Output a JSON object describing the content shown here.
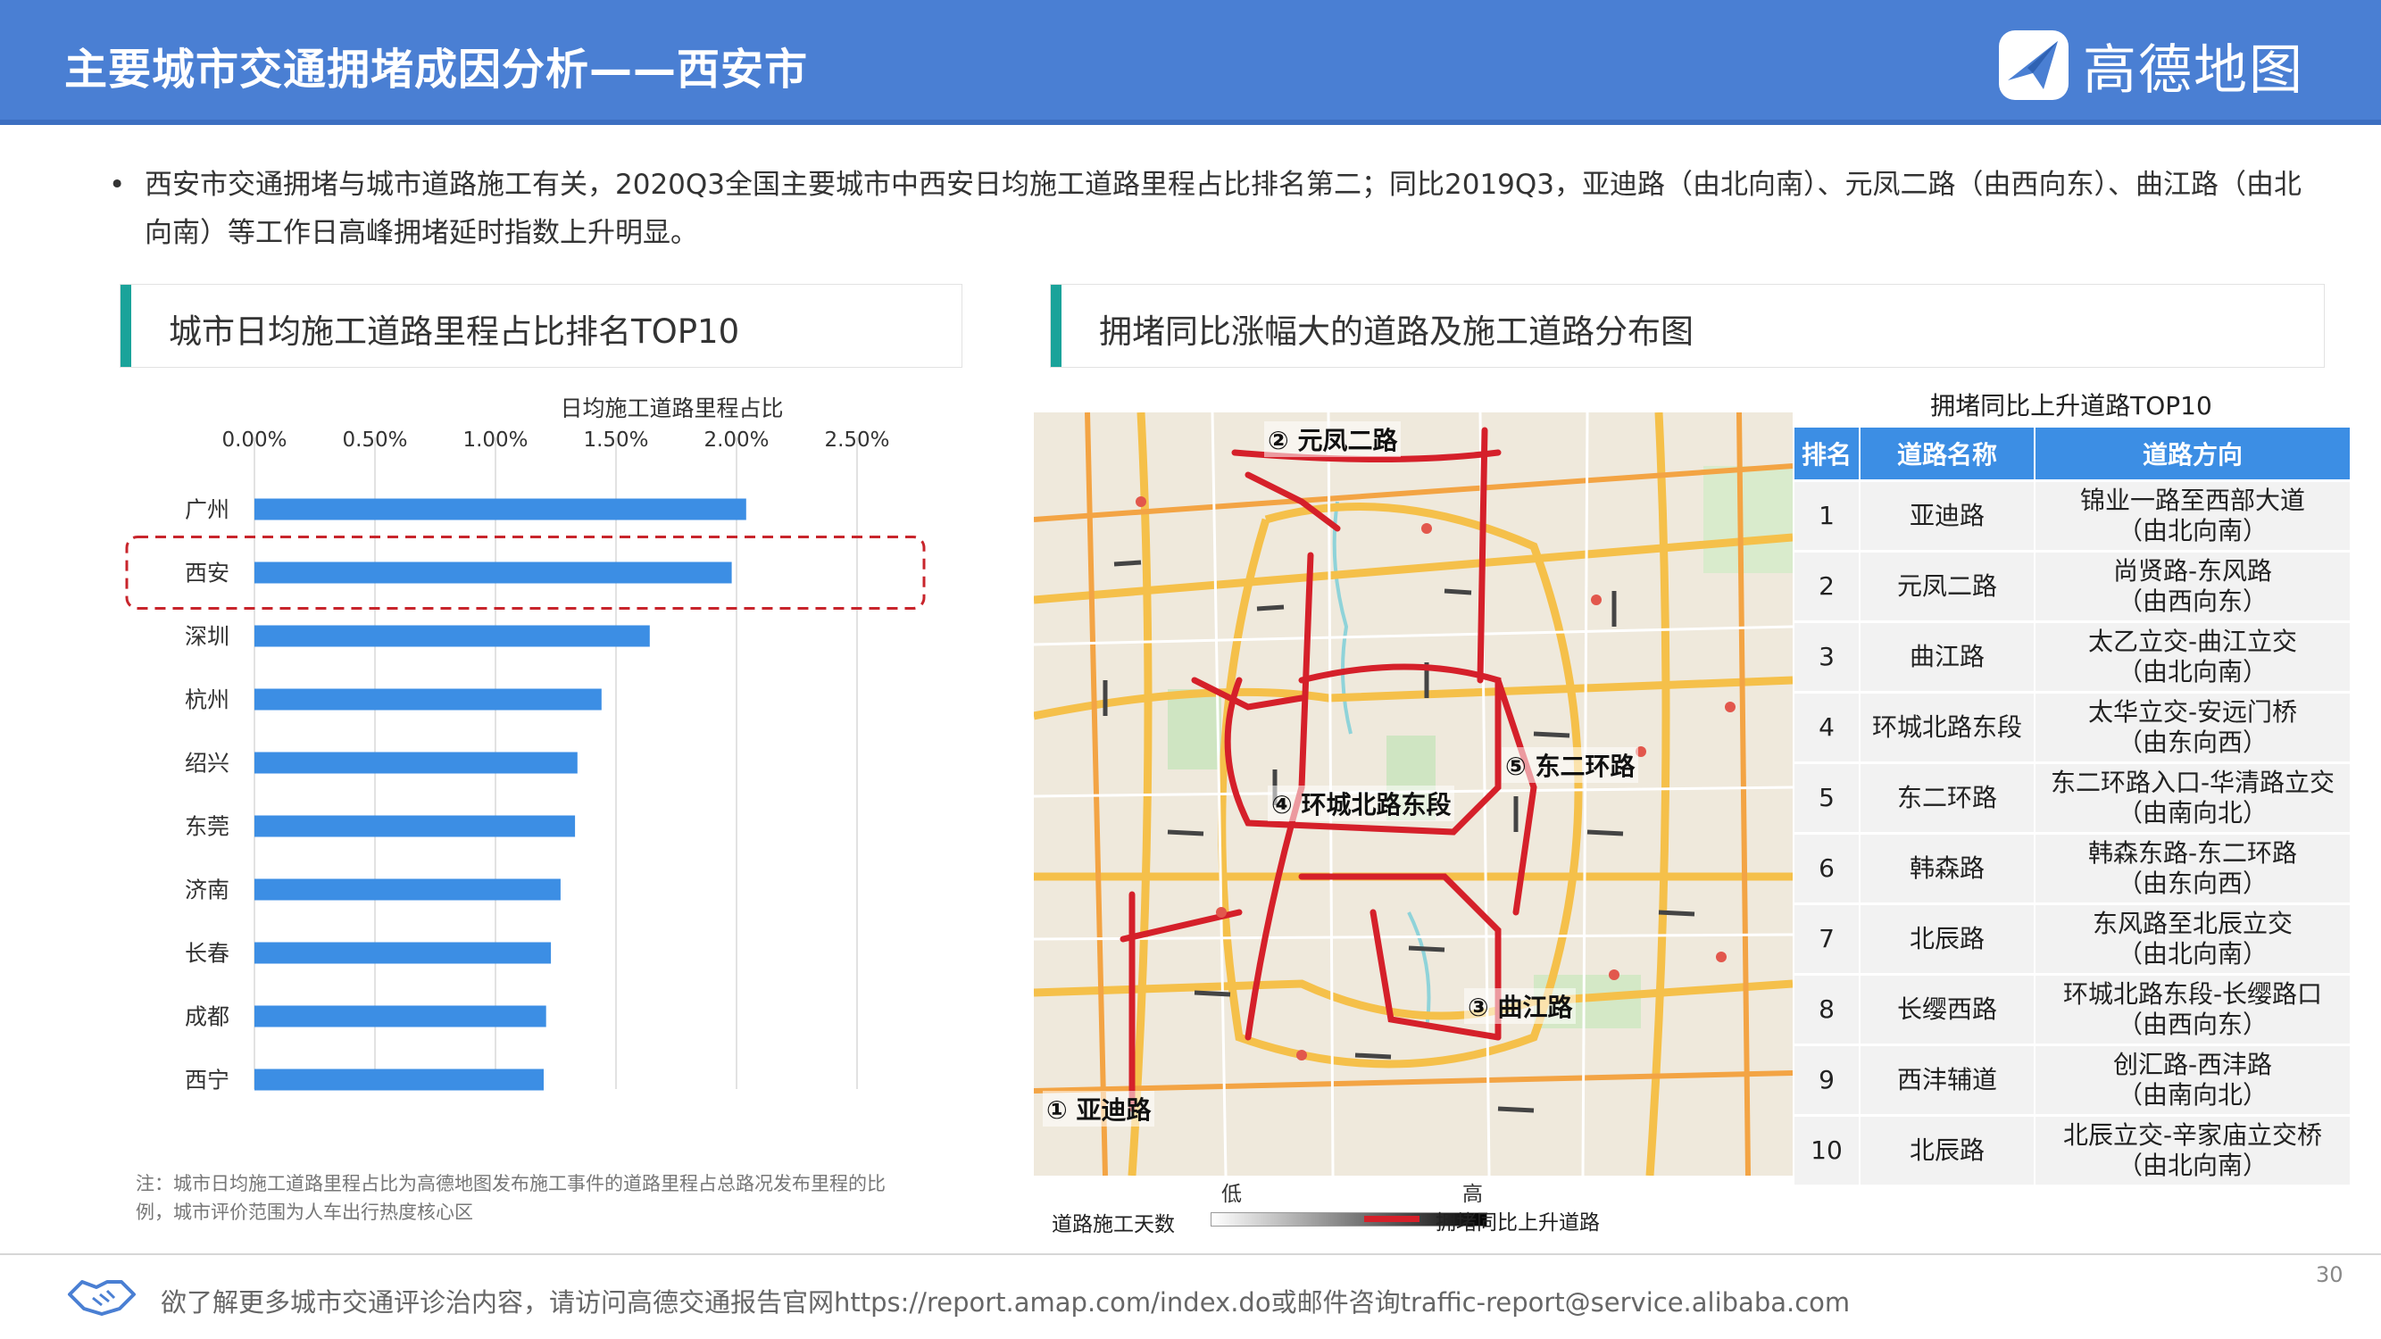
{
  "header": {
    "title": "主要城市交通拥堵成因分析——西安市",
    "brand": "高德地图"
  },
  "bullet": "西安市交通拥堵与城市道路施工有关，2020Q3全国主要城市中西安日均施工道路里程占比排名第二；同比2019Q3，亚迪路（由北向南）、元凤二路（由西向东）、曲江路（由北向南）等工作日高峰拥堵延时指数上升明显。",
  "left_panel": {
    "title": "城市日均施工道路里程占比排名TOP10"
  },
  "right_panel": {
    "title": "拥堵同比涨幅大的道路及施工道路分布图"
  },
  "chart_data": {
    "type": "bar",
    "orientation": "horizontal",
    "title": "",
    "xlabel": "日均施工道路里程占比",
    "categories": [
      "广州",
      "西安",
      "深圳",
      "杭州",
      "绍兴",
      "东莞",
      "济南",
      "长春",
      "成都",
      "西宁"
    ],
    "values": [
      2.04,
      1.98,
      1.64,
      1.44,
      1.34,
      1.33,
      1.27,
      1.23,
      1.21,
      1.2
    ],
    "xlim": [
      0,
      2.5
    ],
    "ticks": [
      "0.00%",
      "0.50%",
      "1.00%",
      "1.50%",
      "2.00%",
      "2.50%"
    ],
    "tick_values": [
      0,
      0.5,
      1.0,
      1.5,
      2.0,
      2.5
    ],
    "highlight": "西安",
    "bar_color": "#3c8ee4",
    "grid": true
  },
  "note": "注：城市日均施工道路里程占比为高德地图发布施工事件的道路里程占总路况发布里程的比例，城市评价范围为人车出行热度核心区",
  "map": {
    "labels": [
      "① 亚迪路",
      "② 元凤二路",
      "③ 曲江路",
      "④ 环城北路东段",
      "⑤ 东二环路"
    ],
    "legend_construction": "道路施工天数",
    "legend_low": "低",
    "legend_high": "高",
    "legend_congestion": "拥堵同比上升道路",
    "road_color": "#d5202a"
  },
  "table": {
    "title": "拥堵同比上升道路TOP10",
    "headers": [
      "排名",
      "道路名称",
      "道路方向"
    ],
    "rows": [
      {
        "rank": "1",
        "name": "亚迪路",
        "dir1": "锦业一路至西部大道",
        "dir2": "（由北向南）"
      },
      {
        "rank": "2",
        "name": "元凤二路",
        "dir1": "尚贤路-东风路",
        "dir2": "（由西向东）"
      },
      {
        "rank": "3",
        "name": "曲江路",
        "dir1": "太乙立交-曲江立交",
        "dir2": "（由北向南）"
      },
      {
        "rank": "4",
        "name": "环城北路东段",
        "dir1": "太华立交-安远门桥",
        "dir2": "（由东向西）"
      },
      {
        "rank": "5",
        "name": "东二环路",
        "dir1": "东二环路入口-华清路立交",
        "dir2": "（由南向北）"
      },
      {
        "rank": "6",
        "name": "韩森路",
        "dir1": "韩森东路-东二环路",
        "dir2": "（由东向西）"
      },
      {
        "rank": "7",
        "name": "北辰路",
        "dir1": "东风路至北辰立交",
        "dir2": "（由北向南）"
      },
      {
        "rank": "8",
        "name": "长缨西路",
        "dir1": "环城北路东段-长缨路口",
        "dir2": "（由西向东）"
      },
      {
        "rank": "9",
        "name": "西沣辅道",
        "dir1": "创汇路-西沣路",
        "dir2": "（由南向北）"
      },
      {
        "rank": "10",
        "name": "北辰路",
        "dir1": "北辰立交-辛家庙立交桥",
        "dir2": "（由北向南）"
      }
    ]
  },
  "footer": {
    "text": "欲了解更多城市交通评诊治内容，请访问高德交通报告官网https://report.amap.com/index.do或邮件咨询traffic-report@service.alibaba.com",
    "page": "30"
  }
}
